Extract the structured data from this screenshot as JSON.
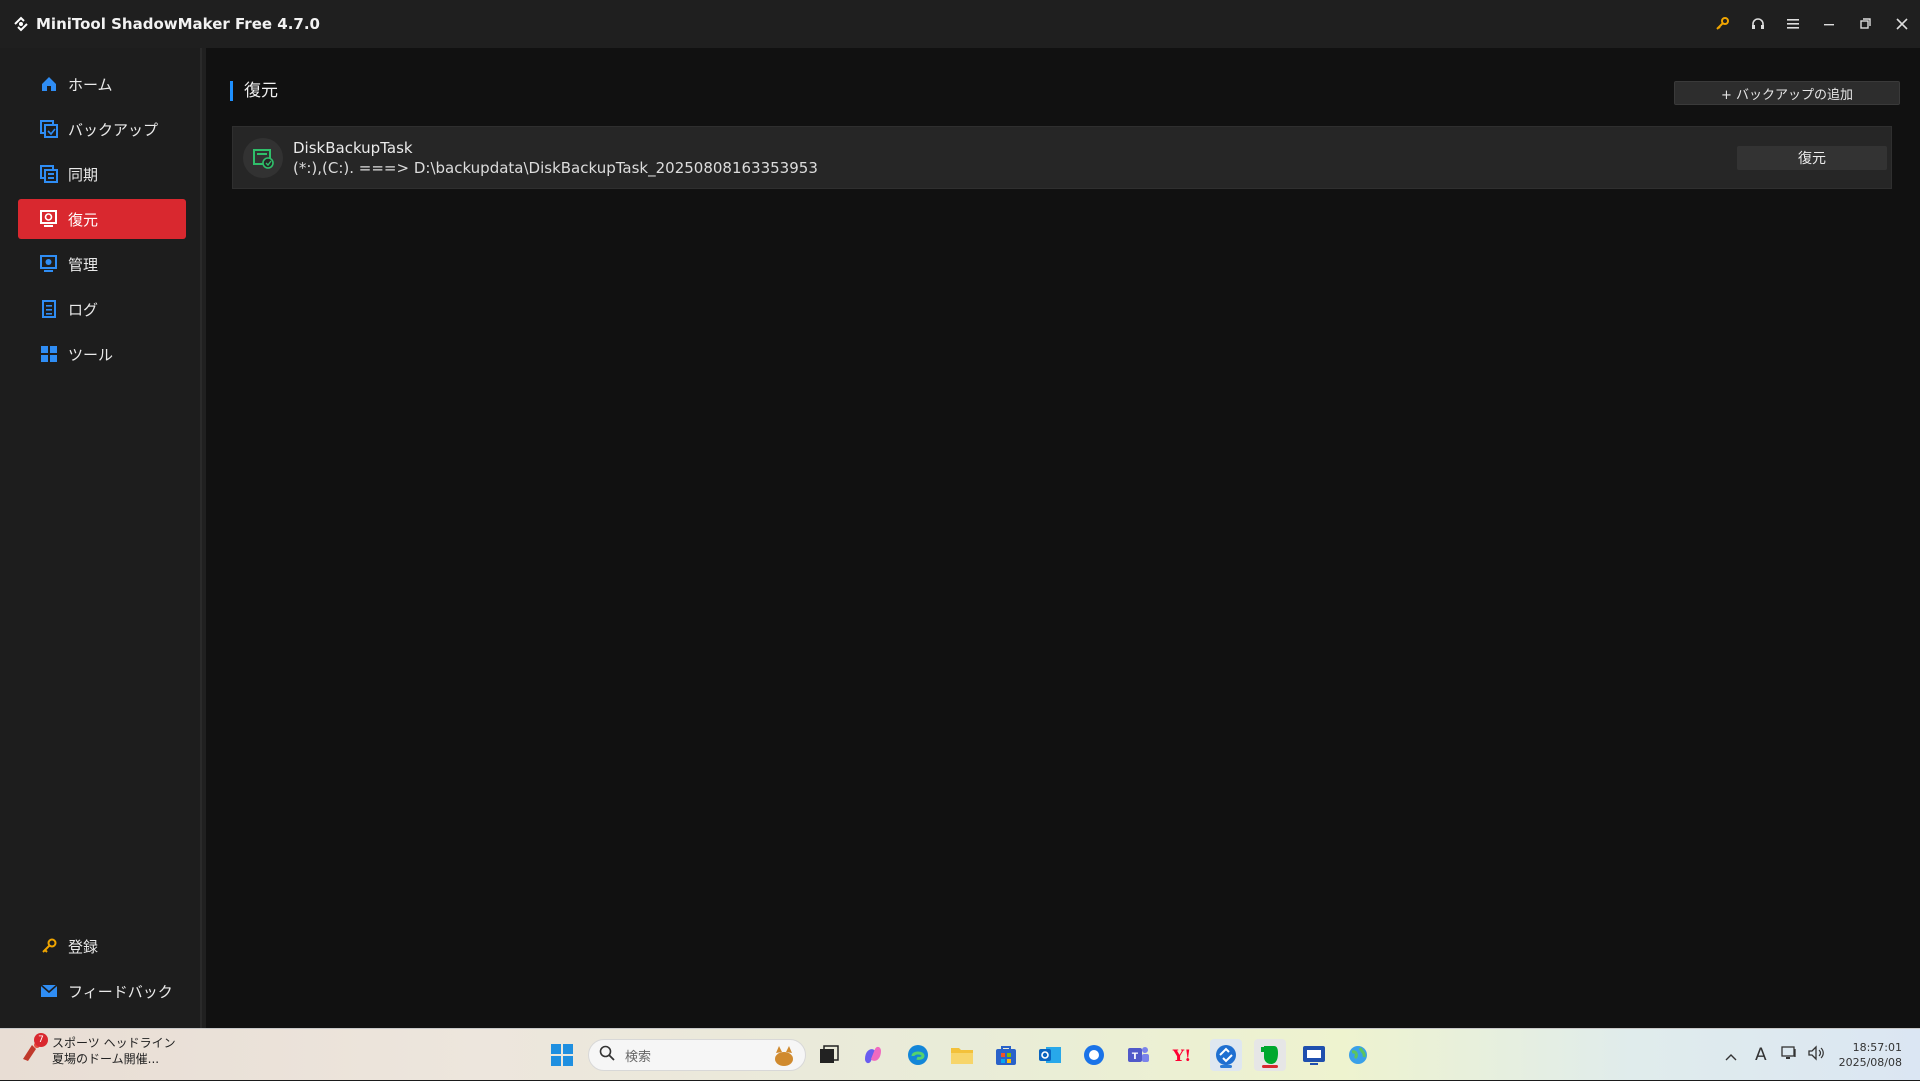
{
  "window": {
    "title": "MiniTool ShadowMaker Free 4.7.0",
    "controls": [
      "key-icon",
      "headset-icon",
      "menu-icon",
      "minimize-icon",
      "restore-icon",
      "close-icon"
    ]
  },
  "sidebar": {
    "items": [
      {
        "label": "ホーム",
        "icon": "home-icon"
      },
      {
        "label": "バックアップ",
        "icon": "backup-icon"
      },
      {
        "label": "同期",
        "icon": "sync-icon"
      },
      {
        "label": "復元",
        "icon": "restore-icon",
        "active": true
      },
      {
        "label": "管理",
        "icon": "manage-icon"
      },
      {
        "label": "ログ",
        "icon": "log-icon"
      },
      {
        "label": "ツール",
        "icon": "tools-icon"
      }
    ],
    "bottom": [
      {
        "label": "登録",
        "icon": "key-icon"
      },
      {
        "label": "フィードバック",
        "icon": "mail-icon"
      }
    ]
  },
  "main": {
    "title": "復元",
    "add_backup_label": "+ バックアップの追加",
    "tasks": [
      {
        "name": "DiskBackupTask",
        "path": "(*:),(C:). ===> D:\\backupdata\\DiskBackupTask_20250808163353953",
        "restore_label": "復元"
      }
    ]
  },
  "taskbar": {
    "news": {
      "badge": "7",
      "line1": "スポーツ ヘッドライン",
      "line2": "夏場のドーム開催..."
    },
    "search_placeholder": "検索",
    "clock": {
      "time": "18:57:01",
      "date": "2025/08/08"
    },
    "ime": "A"
  },
  "colors": {
    "accent_red": "#d9282f",
    "accent_blue": "#1e90ff",
    "background": "#111111"
  }
}
